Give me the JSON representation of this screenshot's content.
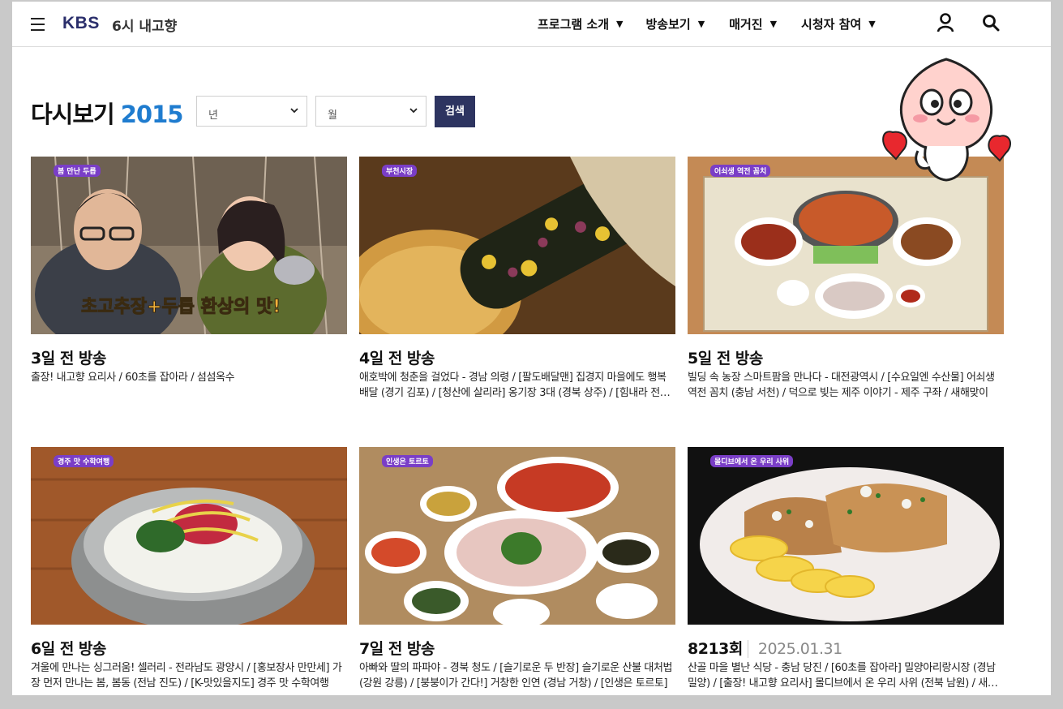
{
  "header": {
    "logo": "KBS",
    "site_title": "6시 내고향",
    "nav": [
      {
        "label": "프로그램 소개"
      },
      {
        "label": "방송보기"
      },
      {
        "label": "매거진"
      },
      {
        "label": "시청자 참여"
      }
    ]
  },
  "toolbar": {
    "title": "다시보기",
    "year": "2015",
    "year_select": "년",
    "month_select": "월",
    "search_label": "검색"
  },
  "episodes": [
    {
      "title": "3일 전 방송",
      "badge": "봄 만난 두릅",
      "desc": "출장! 내고향 요리사 / 60초를 잡아라 / 섬섬옥수"
    },
    {
      "title": "4일 전 방송",
      "badge": "부천시장",
      "desc": "애호박에 청춘을 걸었다 - 경남 의령 / [팔도배달맨] 집경지 마을에도 행복 배달 (경기 김포) / [청산에 살리라] 옹기장 3대 (경북 상주) / [힘내라 전통시장] 부천시장"
    },
    {
      "title": "5일 전 방송",
      "badge": "어쇠생 역전 꼼치",
      "desc": "빌딩 속 농장 스마트팜을 만나다 - 대전광역시 / [수요일엔 수산물] 어쇠생 역전 꼼치 (충남 서천) / 덕으로 빚는 제주 이야기 - 제주 구좌 / 새해맞이"
    },
    {
      "title": "6일 전 방송",
      "badge": "경주 맛 수학여행",
      "desc": "겨울에 만나는 싱그러움! 셀러리 - 전라남도 광양시 / [홍보장사 만만세] 가장 먼저 만나는 봄, 봄동 (전남 진도) / [K-맛있을지도] 경주 맛 수학여행"
    },
    {
      "title": "7일 전 방송",
      "badge": "인생은 토르토",
      "desc": "아빠와 딸의 파파야 - 경북 청도 / [슬기로운 두 반장] 슬기로운 산불 대처법 (강원 강릉) / [붕붕이가 간다!] 거창한 인연 (경남 거창) / [인생은 토르토]"
    },
    {
      "title": "8213회",
      "date": "2025.01.31",
      "badge": "몰디브에서 온 우리 사위",
      "desc": "산골 마을 별난 식당 - 충남 당진 / [60초를 잡아라] 밀양아리랑시장 (경남 밀양) / [출장! 내고향 요리사] 몰디브에서 온 우리 사위 (전북 남원) / 새해 인사"
    }
  ],
  "thumb_overlay": {
    "text": "초고추장+두릅 환상의 맛!"
  }
}
